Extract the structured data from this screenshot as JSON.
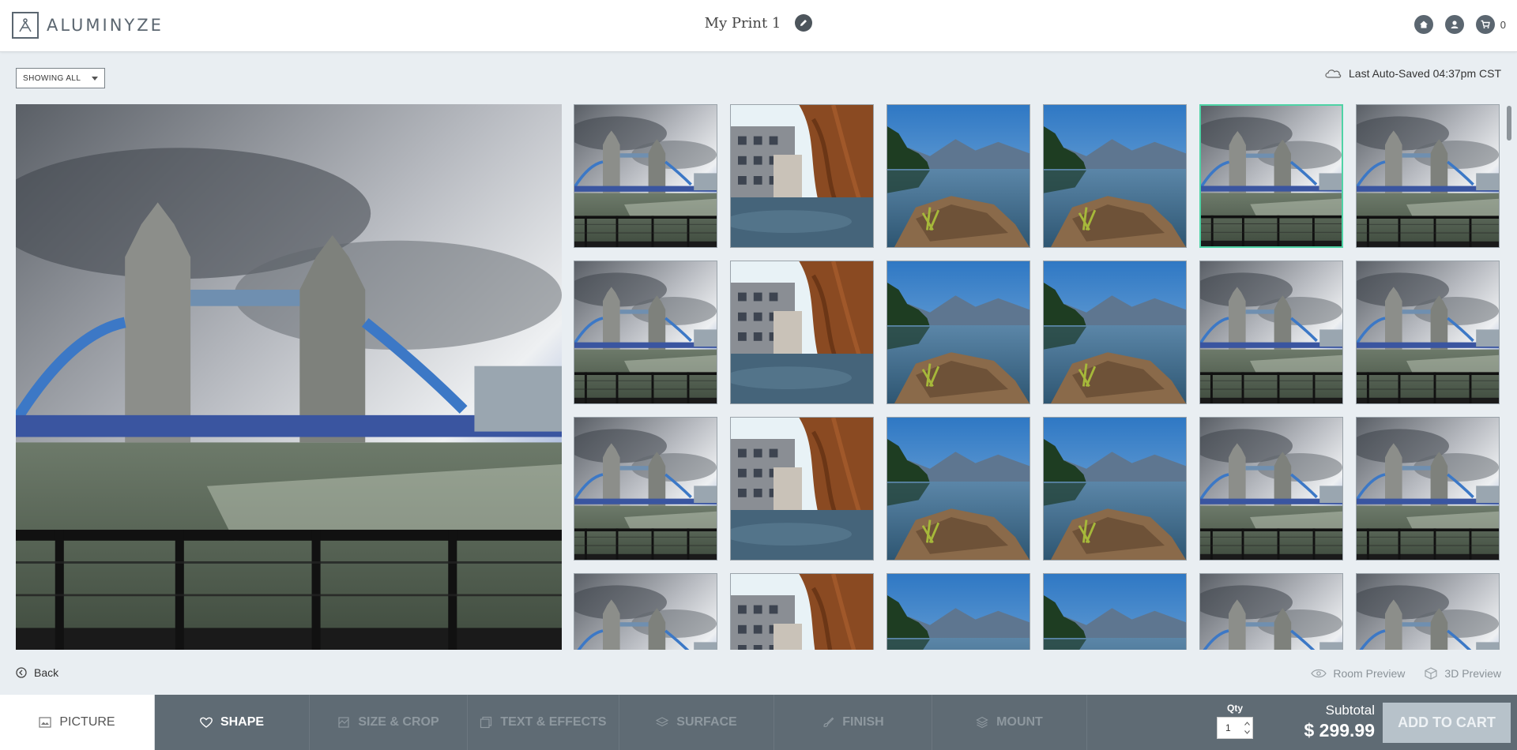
{
  "header": {
    "logo_text": "ALUMINYZE",
    "title": "My Print 1",
    "cart_count": "0"
  },
  "toolbar": {
    "filter_value": "SHOWING ALL",
    "autosave_text": "Last Auto-Saved 04:37pm CST"
  },
  "gallery": {
    "photos": [
      "tower-bridge",
      "canal-willow",
      "mountain-lake",
      "mountain-lake",
      "tower-bridge",
      "tower-bridge"
    ],
    "selected_index": 4,
    "rows_visible": 4
  },
  "footer_nav": {
    "back_label": "Back",
    "room_preview_label": "Room Preview",
    "preview_3d_label": "3D Preview"
  },
  "tabs": [
    {
      "label": "PICTURE",
      "icon": "picture-icon"
    },
    {
      "label": "SHAPE",
      "icon": "heart-icon"
    },
    {
      "label": "SIZE & CROP",
      "icon": "crop-icon"
    },
    {
      "label": "TEXT & EFFECTS",
      "icon": "layers-image-icon"
    },
    {
      "label": "SURFACE",
      "icon": "surface-icon"
    },
    {
      "label": "FINISH",
      "icon": "brush-icon"
    },
    {
      "label": "MOUNT",
      "icon": "stack-icon"
    }
  ],
  "order": {
    "qty_label": "Qty",
    "qty_value": "1",
    "subtotal_label": "Subtotal",
    "subtotal_value": "$ 299.99",
    "add_to_cart_label": "ADD TO CART"
  },
  "colors": {
    "accent_selected": "#4fd3a6",
    "bottom_bar": "#5f6b74",
    "page_bg": "#e9eef2"
  }
}
